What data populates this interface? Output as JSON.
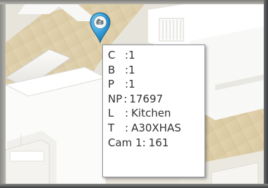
{
  "marker": {
    "icon": "camera-icon",
    "pin_color": "#2f9bd6"
  },
  "info": {
    "rows": [
      {
        "key": "C",
        "sep": ":",
        "value": "1"
      },
      {
        "key": "B",
        "sep": ":",
        "value": "1"
      },
      {
        "key": "P",
        "sep": ":",
        "value": "1"
      },
      {
        "key": "NP",
        "sep": ":",
        "value": "17697"
      },
      {
        "key": "L",
        "sep": ":",
        "value": "Kitchen"
      },
      {
        "key": "T",
        "sep": ":",
        "value": "A30XHAS"
      },
      {
        "key": "Cam 1",
        "sep": ":",
        "value": "161"
      }
    ]
  }
}
